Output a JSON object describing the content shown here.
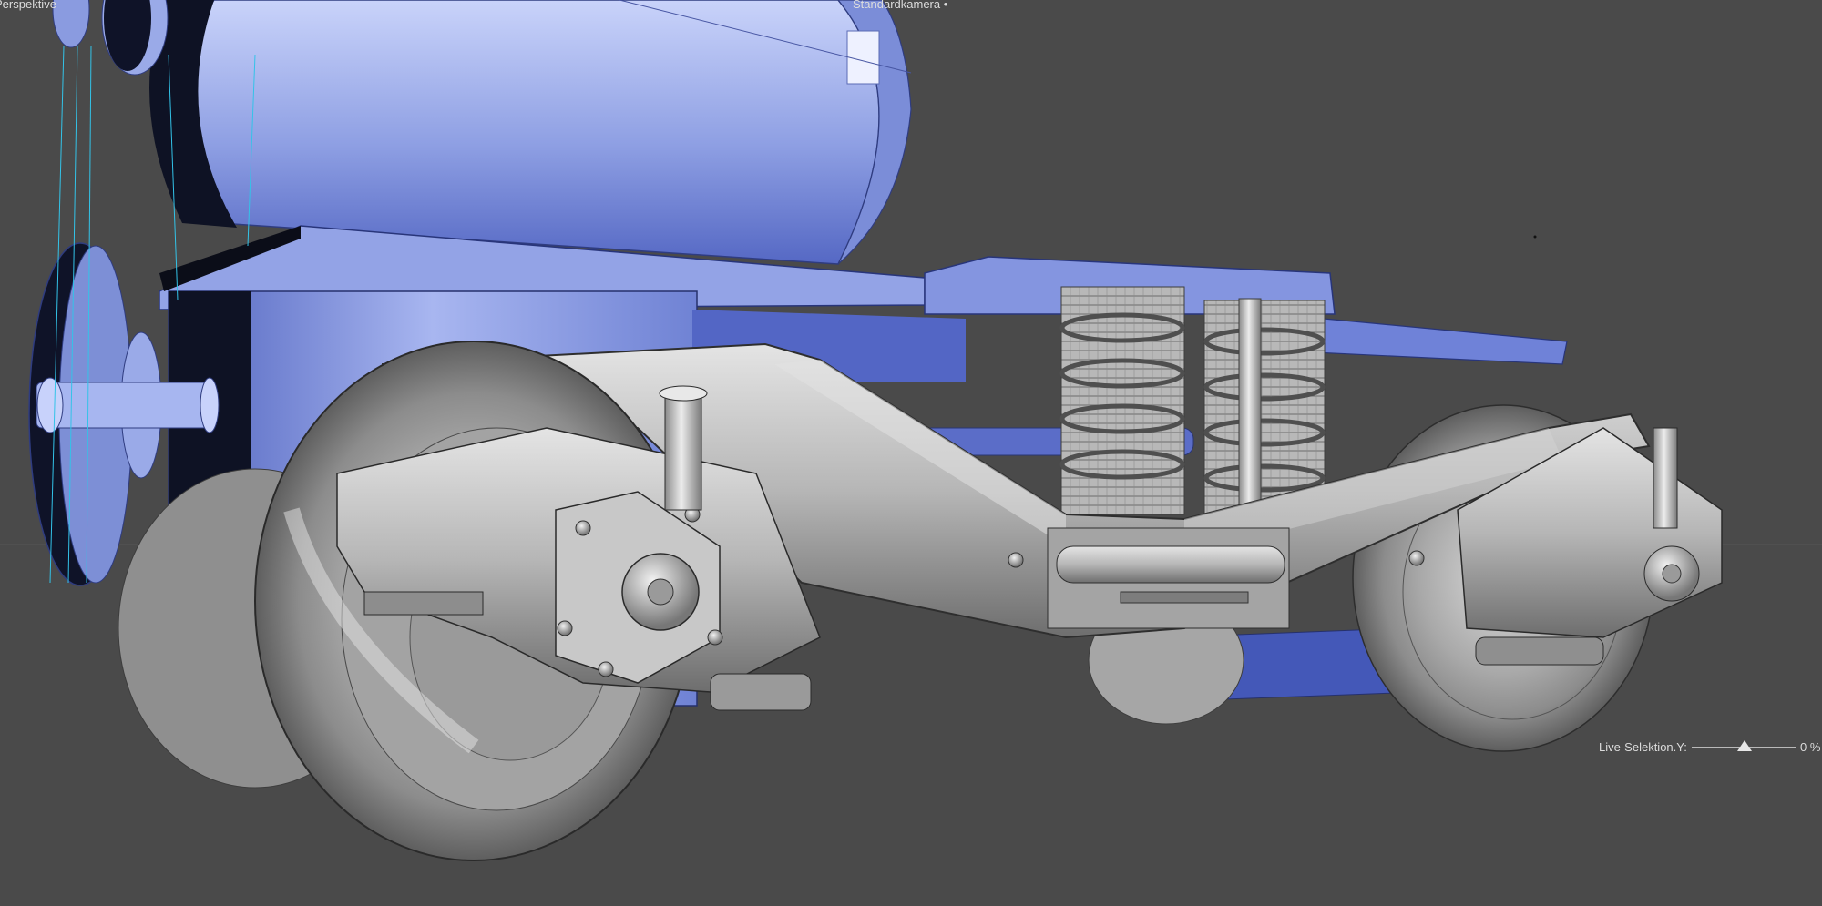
{
  "viewport": {
    "view_name": "Perspektive",
    "camera_name": "Standardkamera",
    "camera_suffix": " •",
    "background_color": "#4a4a4a",
    "horizon_color": "#555555",
    "model_colors": {
      "blue": "#7d8fd6",
      "blue_dark": "#3c4fa3",
      "metal": "#b3b3b3",
      "metal_dark": "#5e5e5e",
      "wire": "#33c3e8"
    }
  },
  "live_selection": {
    "label": "Live-Selektion.Y:",
    "value_text": "0 %",
    "value_percent": 0
  }
}
